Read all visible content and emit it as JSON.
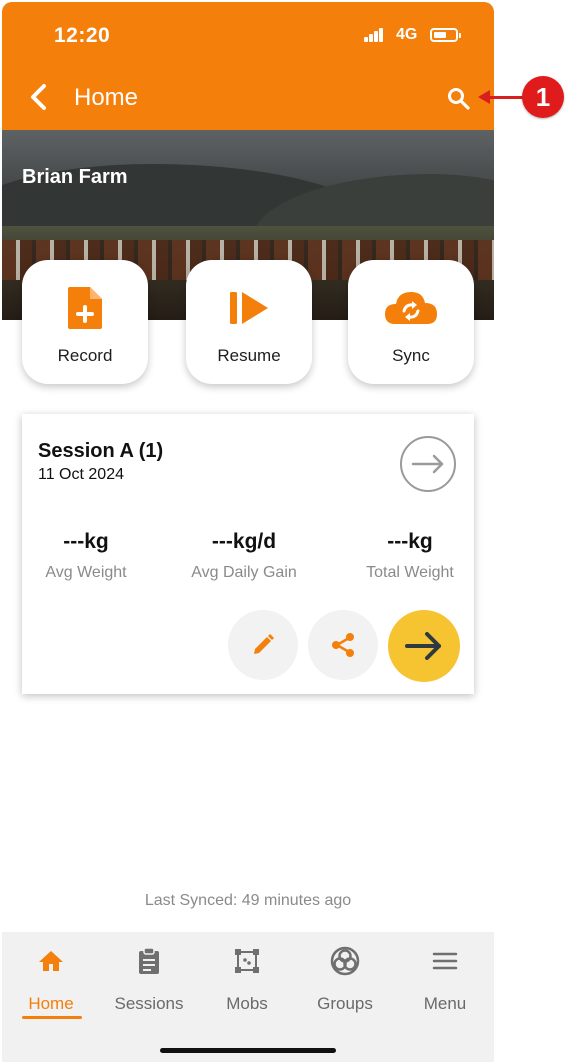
{
  "status_bar": {
    "time": "12:20",
    "network": "4G",
    "battery_level": 0.5
  },
  "header": {
    "title": "Home",
    "back_icon": "chevron-left-icon",
    "search_icon": "search-icon"
  },
  "hero": {
    "farm_name": "Brian Farm"
  },
  "actions": [
    {
      "label": "Record",
      "icon": "file-plus-icon"
    },
    {
      "label": "Resume",
      "icon": "resume-icon"
    },
    {
      "label": "Sync",
      "icon": "cloud-sync-icon"
    }
  ],
  "session": {
    "title": "Session A (1)",
    "date": "11 Oct 2024",
    "stats": [
      {
        "value": "---kg",
        "label": "Avg Weight"
      },
      {
        "value": "---kg/d",
        "label": "Avg Daily Gain"
      },
      {
        "value": "---kg",
        "label": "Total Weight"
      }
    ]
  },
  "last_synced": "Last Synced: 49 minutes ago",
  "nav": [
    {
      "label": "Home",
      "icon": "home-icon",
      "active": true
    },
    {
      "label": "Sessions",
      "icon": "clipboard-icon"
    },
    {
      "label": "Mobs",
      "icon": "mobs-icon"
    },
    {
      "label": "Groups",
      "icon": "groups-icon"
    },
    {
      "label": "Menu",
      "icon": "menu-icon"
    }
  ],
  "annotation": {
    "number": "1"
  },
  "colors": {
    "accent": "#f47f0a",
    "go_button": "#f6c331",
    "annotation": "#e01b1b"
  }
}
